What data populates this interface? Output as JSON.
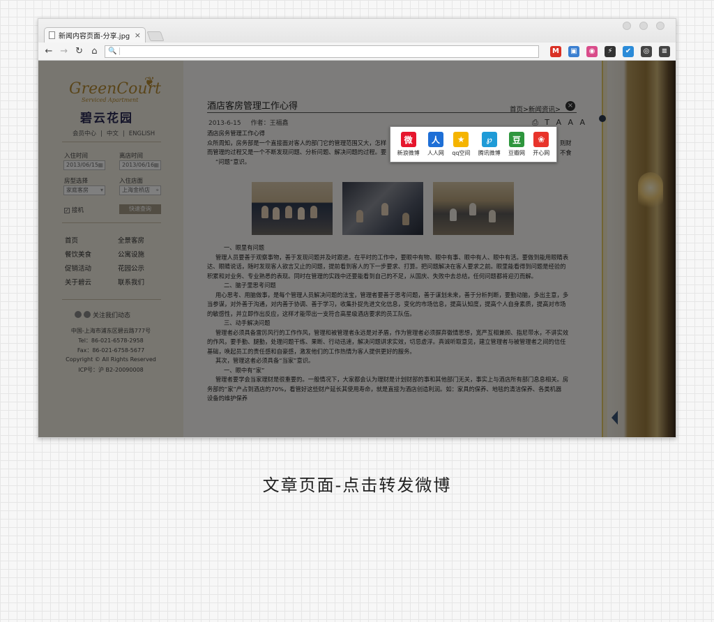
{
  "browser": {
    "tab_title": "新闻内容页面-分享.jpg (1",
    "tab_close": "×",
    "nav": {
      "back": "←",
      "forward": "→",
      "reload": "↻",
      "home": "⌂"
    },
    "url": "",
    "search_glyph": "🔍",
    "extensions": [
      {
        "glyph": "M",
        "color": "#d93025"
      },
      {
        "glyph": "▣",
        "color": "#3a7fd0"
      },
      {
        "glyph": "◉",
        "color": "#d94c8a"
      },
      {
        "glyph": "⚡",
        "color": "#333333"
      },
      {
        "glyph": "✔",
        "color": "#2b8bd8"
      },
      {
        "glyph": "◎",
        "color": "#444444"
      },
      {
        "glyph": "≡",
        "color": "#444444"
      }
    ]
  },
  "sidebar": {
    "logo_en": "GreenCourt",
    "logo_sub": "Serviced Apartment",
    "logo_cn": "碧云花园",
    "lang": [
      "会员中心",
      "|",
      "中文",
      "|",
      "ENGLISH"
    ],
    "checkin_label": "入住时间",
    "checkout_label": "离店时间",
    "checkin_value": "2013/06/15",
    "checkout_value": "2013/06/16",
    "room_label": "房型选择",
    "store_label": "入住店面",
    "room_value": "家庭客房",
    "store_value": "上海金桥店",
    "pickup_label": "接机",
    "search_button": "快速查询",
    "menu": [
      [
        "首页",
        "全景客房"
      ],
      [
        "餐饮美食",
        "公寓设施"
      ],
      [
        "促销活动",
        "花园公示"
      ],
      [
        "关于碧云",
        "联系我们"
      ]
    ],
    "follow": "关注我们动态",
    "address": [
      "中国-上海市浦东区碧云路777号",
      "Tel：86-021-6578-2958",
      "Fax：86-021-6758-5677",
      "Copyright ©  All Rights Reserved",
      "ICP号：沪 B2-20090008"
    ]
  },
  "article": {
    "title": "酒店客房管理工作心得",
    "breadcrumb": "首页>新闻资讯>",
    "close": "×",
    "date": "2013-6-15",
    "author": "作者：王福鑫",
    "tools": "⎙ T A A A",
    "intro": [
      "酒店房务管理工作心得",
      "众所周知，房务部是一个直接面对客人的部门它的管理范围又大，怎样",
      "而管理的过程又是一个不断发现问题、分析问题、解决问题的过程。要",
      "“问题”意识。"
    ],
    "intro_tail": [
      "则财",
      "不食"
    ],
    "paragraphs": [
      "一、眼里有问题",
      "管理人员要善于观察事物，善于发现问题并及时跟进。在平时的工作中，要眼中有物、眼中有事、眼中有人、眼中有活。要做到能用眼睛表",
      "达、眼睛说话，随时发现客人欲言又止的问题，提前看到客人的下一步要求、打算。把问题解决在客人要求之前。眼里能看得到问题是经验的",
      "积累和对业务、专业熟悉的表现。同时在管理的实践中还要能看到自己的不足，从国庆、失败中去总结，任何问题都将迎刃而解。",
      "二、脑子里思考问题",
      "用心思考、用脑做事，是每个管理人员解决问题的法宝，管理者要善于思考问题，善于谋划未来，善于分析判断，要勤动脑，多出主意，多",
      "当参谋，对外善于沟通，对内善于协调、善于学习，收集扑捉先进文化信息，变化的市场信息，提高认知度，提高个人自身素质，提高对市场",
      "的敏感性，并立即作出反应，这样才能带出一支符合高星级酒店要求的员工队伍。",
      "三、动手解决问题",
      "管理者必须具备雷厉风行的工作作风，管理和被管理者永远是对矛盾，作为管理者必须摒弃徽情思想，宽严互相兼顾、指尼带水，不讲实效",
      "的作风，要手勤、腿勤，处理问题干练、果断、行动迅速，解决问题讲求实效，切忌虚浮。真诚听取意见，建立管理者与被管理者之间的信任",
      "基础，唤起员工的责任感和自豪感，激发他们的工作热情为客人提供更好的服务。",
      "其次，管理这者必须具备“当家”意识。",
      "一、眼中有“家”",
      "管理者要学会当家理财是很重要的。一般情况下，大家都会认为理财是计划财部的事和其他部门无关，事实上与酒店所有部门息息相关。房",
      "务部的“家”产占到酒店的70%，看管好这些财产延长其使用寿命，就是直接为酒店创造利润。如：家具的保养、地毯的清洁保养、各类机器",
      "设备的维护保养"
    ]
  },
  "share": {
    "services": [
      {
        "label": "新浪微博",
        "glyph": "微",
        "color": "#e6162d",
        "icon": "sina-weibo-icon"
      },
      {
        "label": "人人网",
        "glyph": "人",
        "color": "#1e6fd6",
        "icon": "renren-icon"
      },
      {
        "label": "qq空间",
        "glyph": "★",
        "color": "#f5b400",
        "icon": "qzone-icon"
      },
      {
        "label": "腾讯微博",
        "glyph": "℘",
        "color": "#1f9bd7",
        "icon": "tencent-weibo-icon"
      },
      {
        "label": "豆瓣网",
        "glyph": "豆",
        "color": "#2e963d",
        "icon": "douban-icon"
      },
      {
        "label": "开心网",
        "glyph": "❀",
        "color": "#e8342b",
        "icon": "kaixin-icon"
      }
    ]
  },
  "caption": "文章页面-点击转发微博",
  "colors": {
    "accent_gold": "#b58b33",
    "overlay": "rgba(0,0,0,0.5)"
  }
}
